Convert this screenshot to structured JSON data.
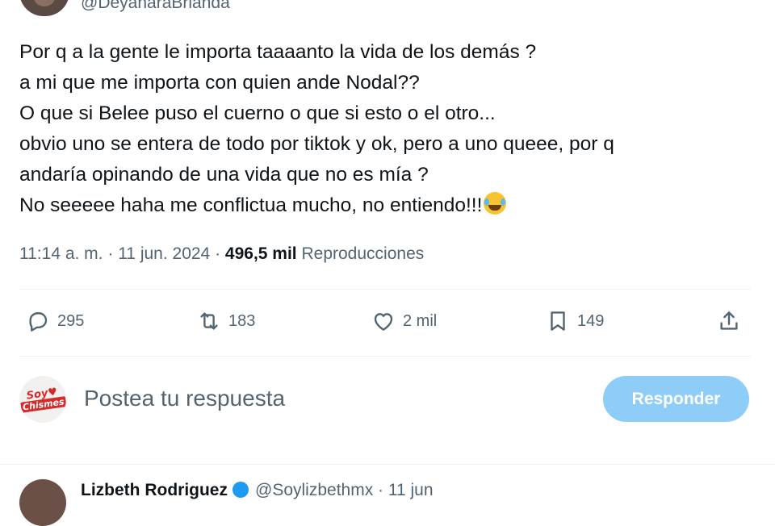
{
  "author": {
    "handle": "@DeyanaraBrianda"
  },
  "tweet": {
    "lines": [
      "Por q a la gente le importa taaaanto la vida de los demás ?",
      "a mi que me importa con quien ande Nodal??",
      "O que si Belee puso el cuerno o que si esto o el otro...",
      "obvio uno se entera de todo por tiktok y ok, pero a uno queee, por q",
      "andaría opinando de una vida que no es mía ?",
      "No seeeee haha me conflictua mucho, no entiendo!!!"
    ],
    "emoji": "face-with-tears-of-joy-icon"
  },
  "meta": {
    "time": "11:14 a. m.",
    "separator": " · ",
    "date": "11 jun. 2024",
    "views_count": "496,5 mil",
    "views_label": "Reproducciones"
  },
  "actions": {
    "replies": "295",
    "reposts": "183",
    "likes": "2 mil",
    "bookmarks": "149"
  },
  "reply_box": {
    "placeholder": "Postea tu respuesta",
    "button": "Responder",
    "button_color": "#8ecdf8"
  },
  "next_reply": {
    "name": "Lizbeth Rodriguez",
    "handle": "@Soylizbethmx · 11 jun"
  },
  "colors": {
    "text": "#0f1419",
    "secondary": "#536471",
    "divider": "#eff3f4"
  }
}
